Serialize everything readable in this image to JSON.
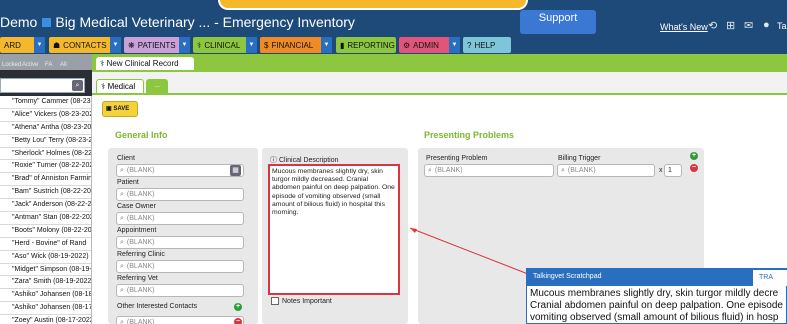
{
  "window": {
    "title_prefix": "Demo",
    "title_main": "Big Medical Veterinary ... - Emergency Inventory",
    "support_label": "Support",
    "whats_new": "What's New",
    "user_initials": "Ta"
  },
  "nav": {
    "items": [
      {
        "label": "ARD",
        "icon": "",
        "color": "#f4b82a"
      },
      {
        "label": "CONTACTS",
        "icon": "contacts-icon",
        "color": "#f4b82a"
      },
      {
        "label": "PATIENTS",
        "icon": "paw-icon",
        "color": "#c9a0d8"
      },
      {
        "label": "CLINICAL",
        "icon": "stethoscope-icon",
        "color": "#8dc63f"
      },
      {
        "label": "FINANCIAL",
        "icon": "money-icon",
        "color": "#f08a24"
      },
      {
        "label": "REPORTING",
        "icon": "chart-icon",
        "color": "#8dc63f"
      },
      {
        "label": "ADMIN",
        "icon": "gear-icon",
        "color": "#e2557a"
      },
      {
        "label": "HELP",
        "icon": "help-icon",
        "color": "#7fc5d8"
      }
    ]
  },
  "filters": [
    "Locked",
    "Active",
    "FA",
    "All"
  ],
  "patients": [
    "\"Tommy\" Cammer (08-23-",
    "\"Alice\" Vickers (08-23-202",
    "\"Athena\" Antha (08-23-20",
    "\"Betty Lou\" Terry (08-23-2",
    "\"Sherlock\" Holmes (08-22",
    "\"Roxie\" Turner (08-22-202",
    "\"Brad\" of Anniston Farmin",
    "\"Bam\" Sustrich (08-22-20",
    "\"Jack\" Anderson (08-22-2",
    "\"Antman\" Stan (08-22-202",
    "\"Boots\" Molony (08-22-20",
    "\"Herd - Bovine\" of Rand",
    "\"Aso\" Wick (08-19-2022)",
    "\"Midget\" Simpson (08-19-",
    "\"Zara\" Smith (08-19-2022",
    "\"Ashiko\" Johansen (08-18",
    "\"Ashiko\" Johansen (08-17",
    "\"Zoey\" Austin (08-17-2022"
  ],
  "record": {
    "tab_label": "New Clinical Record",
    "medical_tab": "Medical",
    "plus_tab": "...",
    "save_label": "SAVE"
  },
  "general_info": {
    "heading": "General Info",
    "blank": "(BLANK)",
    "client": "Client",
    "patient": "Patient",
    "case_owner": "Case Owner",
    "appointment": "Appointment",
    "referring_clinic": "Referring Clinic",
    "referring_vet": "Referring Vet",
    "other_contacts": "Other Interested Contacts"
  },
  "clinical": {
    "label": "Clinical Description",
    "text": "Mucous membranes slightly dry, skin turgor mildly decreased. Cranial abdomen painful on deep palpation. One episode of vomiting observed (small amount of bilious fluid) in hospital this morning.",
    "notes_important": "Notes Important"
  },
  "presenting": {
    "heading": "Presenting Problems",
    "problem_label": "Presenting Problem",
    "billing_label": "Billing Trigger",
    "blank": "(BLANK)",
    "qty_x": "x",
    "qty": "1"
  },
  "scratchpad": {
    "title": "Talkingvet Scratchpad",
    "tab": "TRA",
    "line1": "Mucous membranes slightly dry, skin turgor mildly decre",
    "line2": "Cranial abdomen painful on deep palpation. One episode",
    "line3": "vomiting observed (small amount of bilious fluid) in hosp"
  },
  "colors": {
    "accent_green": "#8dc63f",
    "header_blue": "#1d4a78",
    "highlight_red": "#d9343f",
    "save_yellow": "#f4d23b"
  }
}
